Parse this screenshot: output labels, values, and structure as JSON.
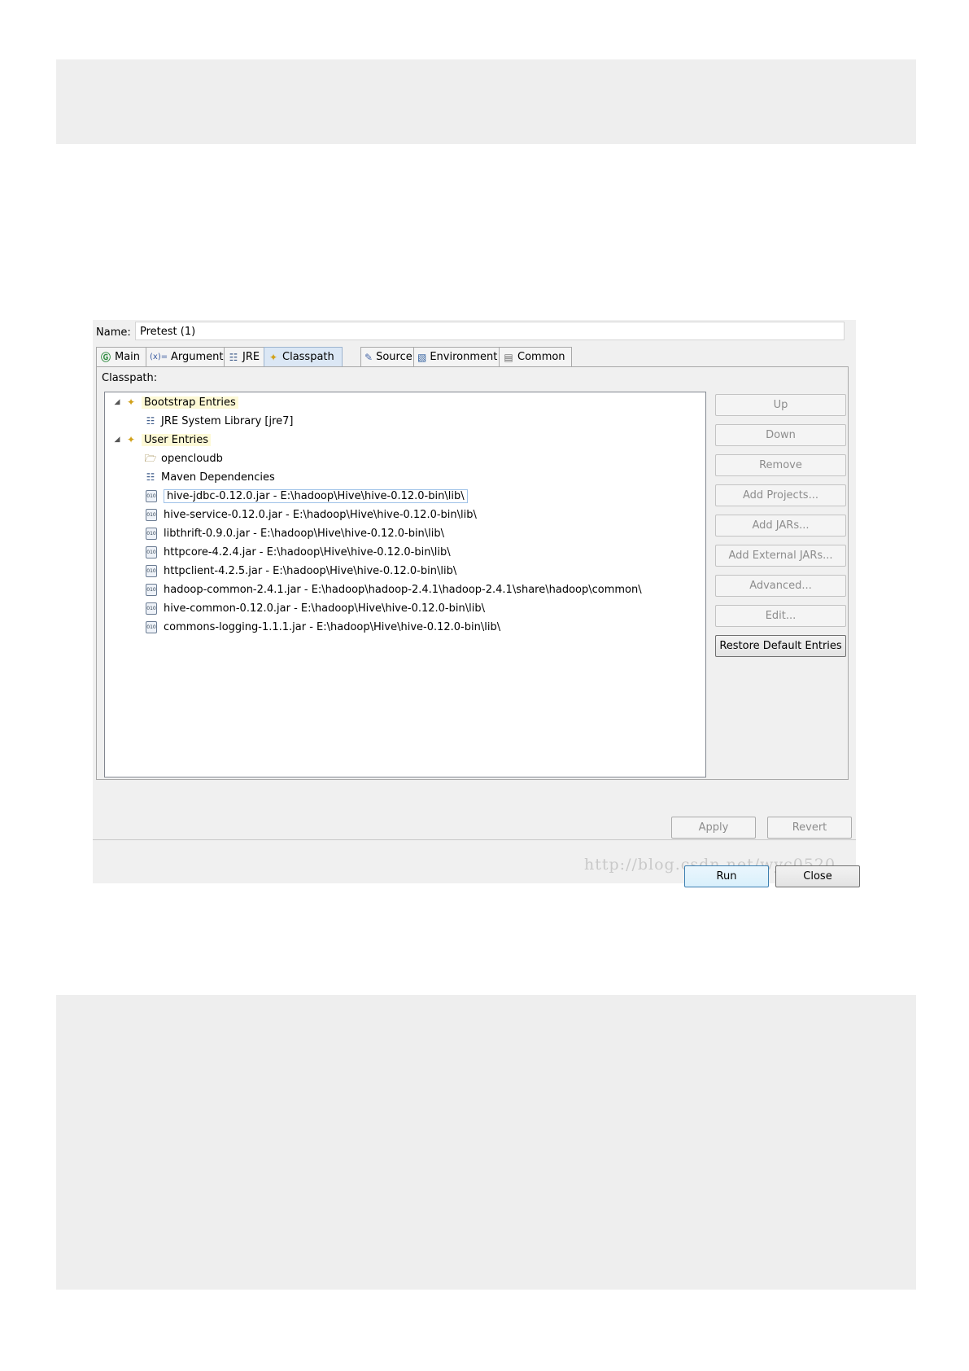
{
  "name": {
    "label": "Name:",
    "value": "Pretest (1)"
  },
  "tabs": [
    {
      "label": "Main",
      "icon": "main-launch-icon"
    },
    {
      "label": "Arguments",
      "icon": "arguments-icon",
      "glyph": "(x)="
    },
    {
      "label": "JRE",
      "icon": "jre-icon"
    },
    {
      "label": "Classpath",
      "icon": "classpath-icon",
      "active": true
    },
    {
      "label": "Source",
      "icon": "source-icon"
    },
    {
      "label": "Environment",
      "icon": "environment-icon"
    },
    {
      "label": "Common",
      "icon": "common-icon"
    }
  ],
  "classpath_label": "Classpath:",
  "tree": {
    "bootstrap": {
      "label": "Bootstrap Entries",
      "children": [
        "JRE System Library [jre7]"
      ]
    },
    "user": {
      "label": "User Entries",
      "children": [
        {
          "label": "opencloudb",
          "icon": "project-folder-icon"
        },
        {
          "label": "Maven Dependencies",
          "icon": "library-icon"
        },
        {
          "label": "hive-jdbc-0.12.0.jar - E:\\hadoop\\Hive\\hive-0.12.0-bin\\lib\\",
          "icon": "jar-icon",
          "selected": true
        },
        {
          "label": "hive-service-0.12.0.jar - E:\\hadoop\\Hive\\hive-0.12.0-bin\\lib\\",
          "icon": "jar-icon"
        },
        {
          "label": "libthrift-0.9.0.jar - E:\\hadoop\\Hive\\hive-0.12.0-bin\\lib\\",
          "icon": "jar-icon"
        },
        {
          "label": "httpcore-4.2.4.jar - E:\\hadoop\\Hive\\hive-0.12.0-bin\\lib\\",
          "icon": "jar-icon"
        },
        {
          "label": "httpclient-4.2.5.jar - E:\\hadoop\\Hive\\hive-0.12.0-bin\\lib\\",
          "icon": "jar-icon"
        },
        {
          "label": "hadoop-common-2.4.1.jar - E:\\hadoop\\hadoop-2.4.1\\hadoop-2.4.1\\share\\hadoop\\common\\",
          "icon": "jar-icon"
        },
        {
          "label": "hive-common-0.12.0.jar - E:\\hadoop\\Hive\\hive-0.12.0-bin\\lib\\",
          "icon": "jar-icon"
        },
        {
          "label": "commons-logging-1.1.1.jar - E:\\hadoop\\Hive\\hive-0.12.0-bin\\lib\\",
          "icon": "jar-icon"
        }
      ]
    }
  },
  "side_buttons": {
    "up": "Up",
    "down": "Down",
    "remove": "Remove",
    "add_projects": "Add Projects...",
    "add_jars": "Add JARs...",
    "add_external_jars": "Add External JARs...",
    "advanced": "Advanced...",
    "edit": "Edit...",
    "restore": "Restore Default Entries"
  },
  "footer": {
    "apply": "Apply",
    "revert": "Revert",
    "run": "Run",
    "close": "Close",
    "watermark": "http://blog.csdn.net/wyc0520"
  }
}
